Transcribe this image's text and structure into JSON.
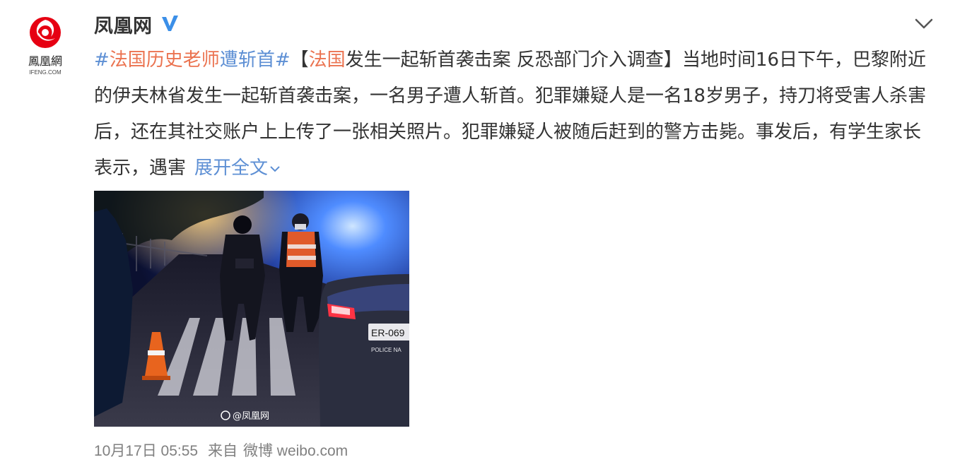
{
  "account": {
    "name": "凤凰网",
    "avatar_text": "鳳凰網",
    "avatar_sub": "IFENG.COM",
    "verified_icon": "verified-v-icon"
  },
  "post": {
    "hashtag_open": "#",
    "hashtag_part1": "法国历史老师",
    "hashtag_part2": "遭斩首",
    "hashtag_close": "#",
    "bracket_open": "【",
    "headline_link": "法国",
    "headline_rest": "发生一起斩首袭击案 反恐部门介入调查",
    "bracket_close": "】",
    "body": "当地时间16日下午，巴黎附近的伊夫林省发生一起斩首袭击案，一名男子遭人斩首。犯罪嫌疑人是一名18岁男子，持刀将受害人杀害后，还在其社交账户上上传了一张相关照片。犯罪嫌疑人被随后赶到的警方击毙。事发后，有学生家长表示，遇害",
    "expand_label": "展开全文"
  },
  "photo": {
    "watermark": "@凤凰网",
    "plate_text": "ER-069",
    "car_text": "POLICE NA"
  },
  "footer": {
    "time": "10月17日 05:55",
    "source_prefix": "来自",
    "source": "微博 weibo.com"
  },
  "colors": {
    "hashtag": "#eb7350",
    "link_blue": "#5d8fd4",
    "footer_gray": "#808080"
  }
}
